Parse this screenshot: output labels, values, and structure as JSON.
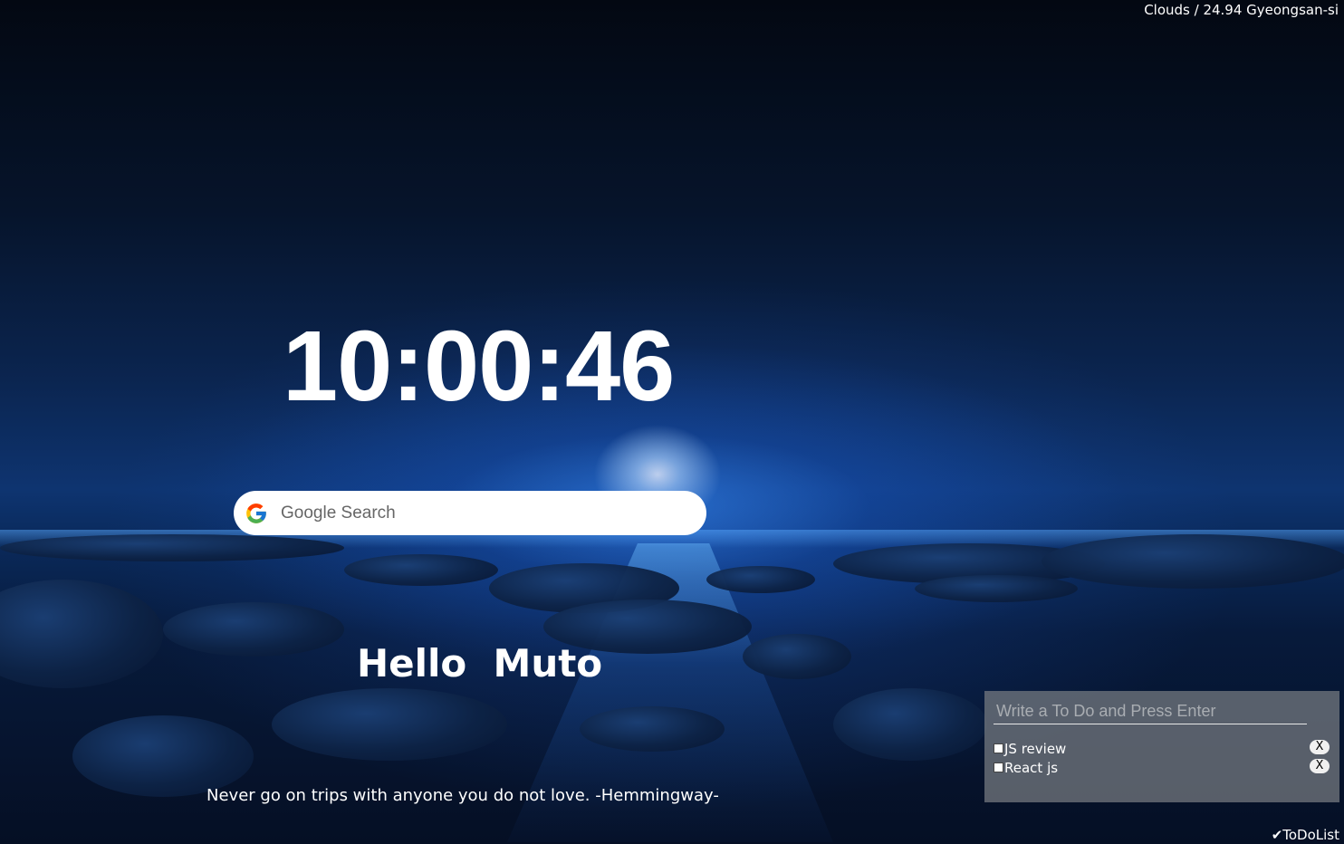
{
  "weather": {
    "text": "Clouds / 24.94 Gyeongsan-si"
  },
  "clock": {
    "time": "10:00:46"
  },
  "search": {
    "placeholder": "Google Search",
    "icon": "google-g-icon"
  },
  "greeting": {
    "text": "Hello  Muto"
  },
  "quote": {
    "text": "Never go on trips with anyone you do not love. -Hemmingway-"
  },
  "todo": {
    "input_placeholder": "Write a To Do and Press Enter",
    "items": [
      {
        "label": "JS review",
        "checked": false,
        "delete_label": "X"
      },
      {
        "label": "React js",
        "checked": false,
        "delete_label": "X"
      }
    ],
    "toggle_label": "✔ToDoList"
  },
  "colors": {
    "text": "#ffffff",
    "panel": "#787d82",
    "sky_dark": "#030812",
    "sky_blue": "#0e3470"
  }
}
